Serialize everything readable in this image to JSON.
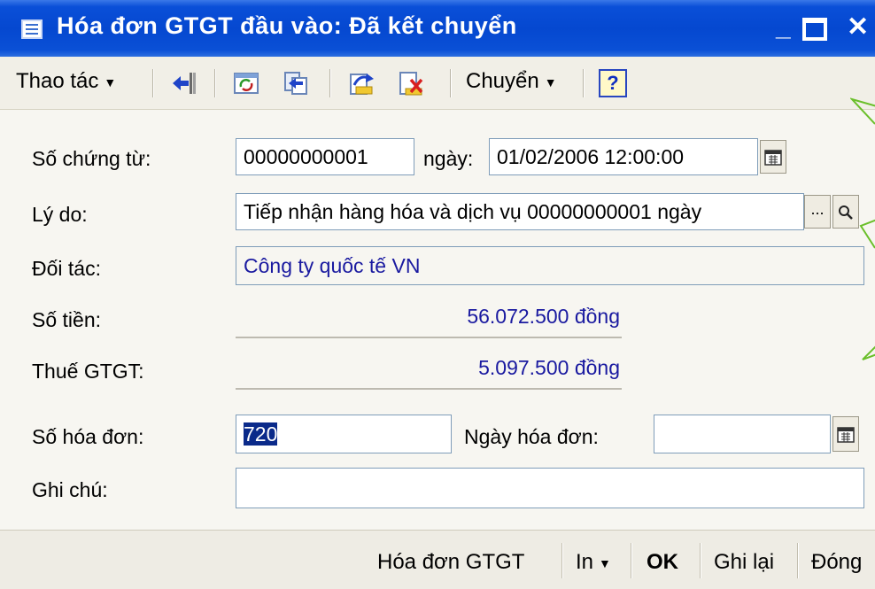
{
  "window": {
    "title": "Hóa đơn GTGT đầu vào: Đã kết chuyển",
    "min_glyph": "_",
    "close_glyph": "✕"
  },
  "toolbar": {
    "actions_label": "Thao tác",
    "transfer_label": "Chuyển",
    "help_label": "?",
    "icons": [
      "back-arrow-icon",
      "refresh-icon",
      "copy-arrows-icon",
      "redo-icon",
      "delete-icon",
      "help-icon"
    ]
  },
  "form": {
    "doc_no_label": "Số chứng từ:",
    "doc_no_value": "00000000001",
    "date_label": "ngày:",
    "date_value": "01/02/2006 12:00:00",
    "reason_label": "Lý do:",
    "reason_value": "Tiếp nhận hàng hóa và dịch vụ 00000000001 ngày",
    "ellipsis": "...",
    "partner_label": "Đối tác:",
    "partner_value": "Công ty quốc tế VN",
    "amount_label": "Số tiền:",
    "amount_value": "56.072.500 đồng",
    "vat_label": "Thuế GTGT:",
    "vat_value": "5.097.500 đồng",
    "invoice_no_label": "Số hóa đơn:",
    "invoice_no_value": "720",
    "invoice_date_label": "Ngày hóa đơn:",
    "invoice_date_value": "",
    "note_label": "Ghi chú:",
    "note_value": ""
  },
  "bottombar": {
    "vat_invoice": "Hóa đơn GTGT",
    "print": "In",
    "ok": "OK",
    "save": "Ghi lại",
    "close": "Đóng"
  },
  "colors": {
    "titlebar": "#0548d0",
    "readonly_text": "#1a1aa0",
    "selection": "#0a2a8a"
  }
}
